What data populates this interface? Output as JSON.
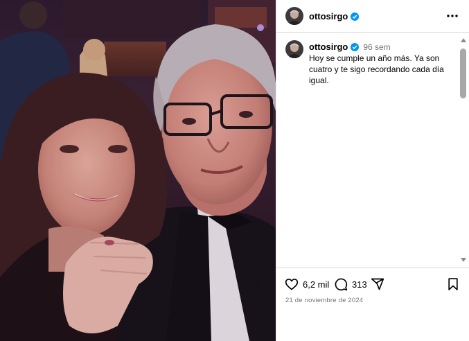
{
  "post": {
    "photo_alt": "selfie",
    "username": "ottosirgo"
  },
  "caption": {
    "username": "ottosirgo",
    "time": "96 sem",
    "text": "Hoy se cumple un año más. Ya son cuatro y te sigo recordando cada día igual."
  },
  "actions": {
    "likes": "6,2 mil",
    "comments": "313",
    "date": "21 de noviembre de 2024"
  },
  "colors": {
    "verified": "#0095f6",
    "secondary_text": "#737373",
    "divider": "#dbdbdb"
  },
  "icons": [
    "verified-icon",
    "more-options-icon",
    "heart-icon",
    "comment-icon",
    "share-icon",
    "bookmark-icon"
  ]
}
